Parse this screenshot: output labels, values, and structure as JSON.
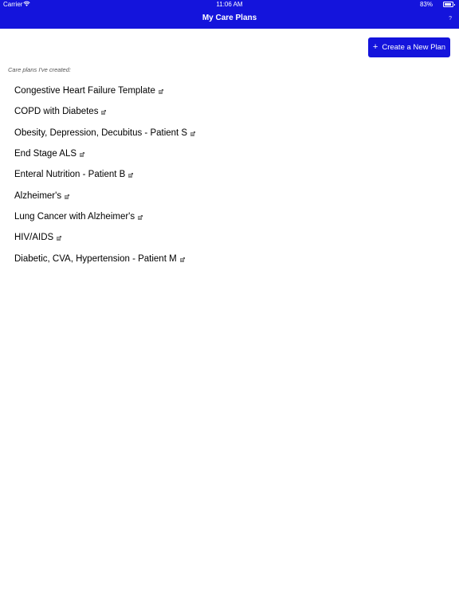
{
  "status_bar": {
    "carrier": "Carrier",
    "time": "11:06 AM",
    "battery": "83%",
    "battery_level": 0.83
  },
  "nav": {
    "title": "My Care Plans",
    "help_label": "?"
  },
  "create_button": {
    "icon": "+",
    "label": "Create a New Plan"
  },
  "section_label": "Care plans I've created:",
  "plans": [
    {
      "label": "Congestive Heart Failure Template"
    },
    {
      "label": "COPD with Diabetes"
    },
    {
      "label": "Obesity, Depression, Decubitus - Patient S"
    },
    {
      "label": "End Stage ALS"
    },
    {
      "label": "Enteral Nutrition - Patient B"
    },
    {
      "label": "Alzheimer's"
    },
    {
      "label": "Lung Cancer with Alzheimer's"
    },
    {
      "label": "HIV/AIDS"
    },
    {
      "label": "Diabetic, CVA, Hypertension - Patient M"
    }
  ],
  "colors": {
    "accent": "#1414dc",
    "text": "#000000",
    "muted": "#555555"
  }
}
